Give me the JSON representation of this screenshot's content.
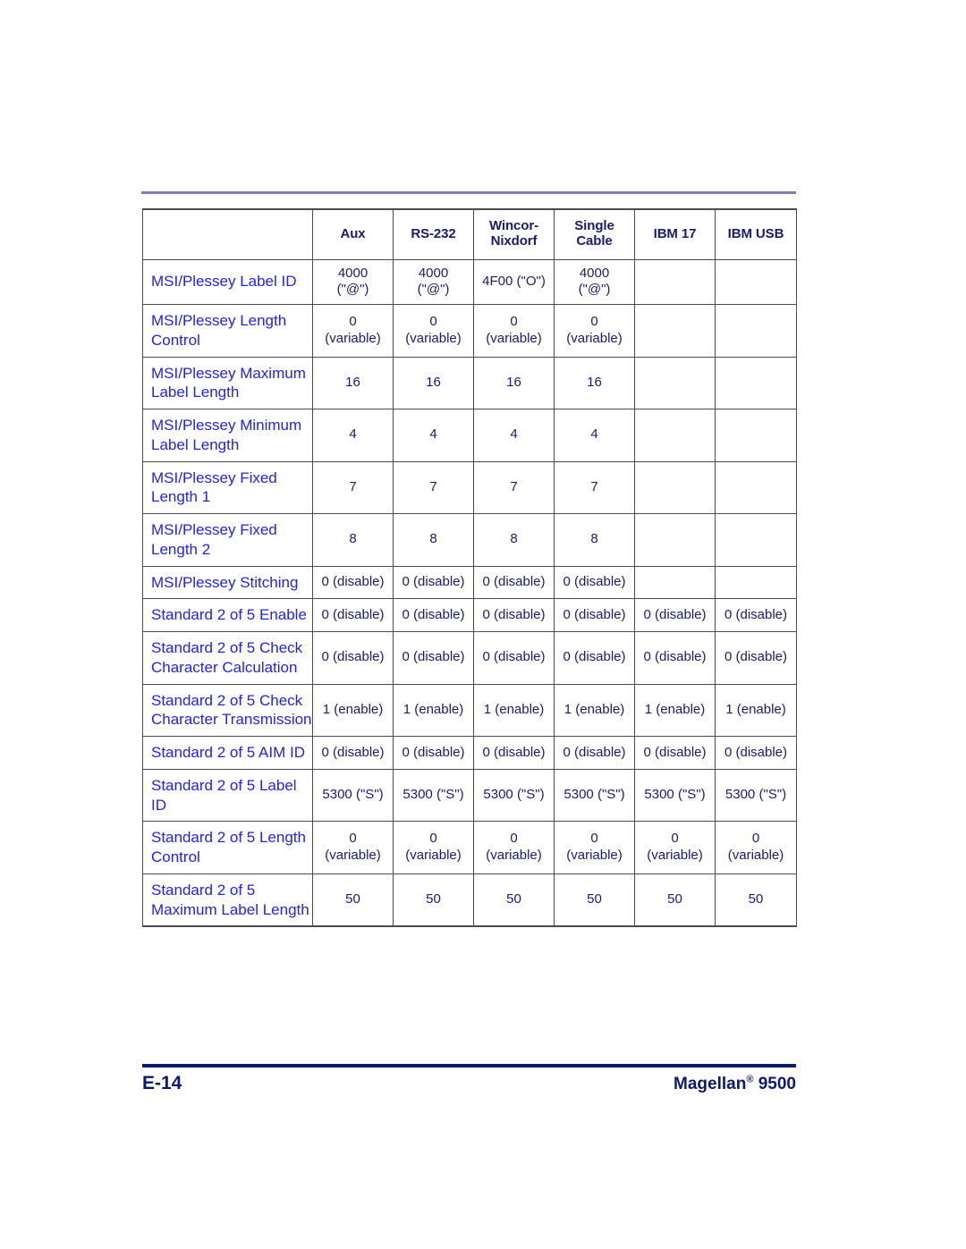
{
  "page": {
    "footer_page_number": "E-14",
    "footer_product_name": "Magellan",
    "footer_product_registered_mark": "®",
    "footer_product_model": "9500",
    "colors": {
      "row_label_blue": "#2222EE",
      "value_navy": "#1A1A6E",
      "footer_navy": "#0D1A6B",
      "top_rule_purple": "#7B7FB5",
      "table_border": "#4B4B4B"
    }
  },
  "table": {
    "columns": [
      {
        "key": "label",
        "header": ""
      },
      {
        "key": "aux",
        "header": "Aux"
      },
      {
        "key": "rs232",
        "header": "RS-232"
      },
      {
        "key": "wincor",
        "header": "Wincor-\nNixdorf"
      },
      {
        "key": "single",
        "header": "Single\nCable"
      },
      {
        "key": "ibm17",
        "header": "IBM 17"
      },
      {
        "key": "ibmusb",
        "header": "IBM USB"
      }
    ],
    "header_labels": {
      "blank": "",
      "aux": "Aux",
      "rs232": "RS-232",
      "wincor_line1": "Wincor-",
      "wincor_line2": "Nixdorf",
      "single_line1": "Single",
      "single_line2": "Cable",
      "ibm17": "IBM 17",
      "ibmusb": "IBM USB"
    },
    "rows": [
      {
        "label": "MSI/Plessey Label ID",
        "aux_main": "4000",
        "aux_sub": "(\"@\")",
        "rs232_main": "4000",
        "rs232_sub": "(\"@\")",
        "wincor_main": "4F00 (\"O\")",
        "wincor_sub": "",
        "single_main": "4000",
        "single_sub": "(\"@\")",
        "ibm17_main": "",
        "ibm17_sub": "",
        "ibmusb_main": "",
        "ibmusb_sub": ""
      },
      {
        "label": "MSI/Plessey Length Control",
        "aux_main": "0",
        "aux_sub": "(variable)",
        "rs232_main": "0",
        "rs232_sub": "(variable)",
        "wincor_main": "0",
        "wincor_sub": "(variable)",
        "single_main": "0",
        "single_sub": "(variable)",
        "ibm17_main": "",
        "ibm17_sub": "",
        "ibmusb_main": "",
        "ibmusb_sub": ""
      },
      {
        "label": "MSI/Plessey Maximum Label Length",
        "aux_main": "16",
        "aux_sub": "",
        "rs232_main": "16",
        "rs232_sub": "",
        "wincor_main": "16",
        "wincor_sub": "",
        "single_main": "16",
        "single_sub": "",
        "ibm17_main": "",
        "ibm17_sub": "",
        "ibmusb_main": "",
        "ibmusb_sub": ""
      },
      {
        "label": "MSI/Plessey Minimum Label Length",
        "aux_main": "4",
        "aux_sub": "",
        "rs232_main": "4",
        "rs232_sub": "",
        "wincor_main": "4",
        "wincor_sub": "",
        "single_main": "4",
        "single_sub": "",
        "ibm17_main": "",
        "ibm17_sub": "",
        "ibmusb_main": "",
        "ibmusb_sub": ""
      },
      {
        "label": "MSI/Plessey Fixed Length 1",
        "aux_main": "7",
        "aux_sub": "",
        "rs232_main": "7",
        "rs232_sub": "",
        "wincor_main": "7",
        "wincor_sub": "",
        "single_main": "7",
        "single_sub": "",
        "ibm17_main": "",
        "ibm17_sub": "",
        "ibmusb_main": "",
        "ibmusb_sub": ""
      },
      {
        "label": "MSI/Plessey Fixed Length 2",
        "aux_main": "8",
        "aux_sub": "",
        "rs232_main": "8",
        "rs232_sub": "",
        "wincor_main": "8",
        "wincor_sub": "",
        "single_main": "8",
        "single_sub": "",
        "ibm17_main": "",
        "ibm17_sub": "",
        "ibmusb_main": "",
        "ibmusb_sub": ""
      },
      {
        "label": "MSI/Plessey Stitching",
        "aux_main": "0 (disable)",
        "aux_sub": "",
        "rs232_main": "0 (disable)",
        "rs232_sub": "",
        "wincor_main": "0 (disable)",
        "wincor_sub": "",
        "single_main": "0 (disable)",
        "single_sub": "",
        "ibm17_main": "",
        "ibm17_sub": "",
        "ibmusb_main": "",
        "ibmusb_sub": ""
      },
      {
        "label": "Standard 2 of 5 Enable",
        "aux_main": "0 (disable)",
        "aux_sub": "",
        "rs232_main": "0 (disable)",
        "rs232_sub": "",
        "wincor_main": "0 (disable)",
        "wincor_sub": "",
        "single_main": "0 (disable)",
        "single_sub": "",
        "ibm17_main": "0 (disable)",
        "ibm17_sub": "",
        "ibmusb_main": "0 (disable)",
        "ibmusb_sub": ""
      },
      {
        "label": "Standard 2 of 5 Check Character Calculation",
        "aux_main": "0 (disable)",
        "aux_sub": "",
        "rs232_main": "0 (disable)",
        "rs232_sub": "",
        "wincor_main": "0 (disable)",
        "wincor_sub": "",
        "single_main": "0 (disable)",
        "single_sub": "",
        "ibm17_main": "0 (disable)",
        "ibm17_sub": "",
        "ibmusb_main": "0 (disable)",
        "ibmusb_sub": ""
      },
      {
        "label": "Standard 2 of 5 Check Character Transmission",
        "aux_main": "1 (enable)",
        "aux_sub": "",
        "rs232_main": "1 (enable)",
        "rs232_sub": "",
        "wincor_main": "1 (enable)",
        "wincor_sub": "",
        "single_main": "1 (enable)",
        "single_sub": "",
        "ibm17_main": "1 (enable)",
        "ibm17_sub": "",
        "ibmusb_main": "1 (enable)",
        "ibmusb_sub": ""
      },
      {
        "label": "Standard 2 of 5 AIM ID",
        "aux_main": "0 (disable)",
        "aux_sub": "",
        "rs232_main": "0 (disable)",
        "rs232_sub": "",
        "wincor_main": "0 (disable)",
        "wincor_sub": "",
        "single_main": "0 (disable)",
        "single_sub": "",
        "ibm17_main": "0 (disable)",
        "ibm17_sub": "",
        "ibmusb_main": "0 (disable)",
        "ibmusb_sub": ""
      },
      {
        "label": "Standard 2 of 5 Label ID",
        "aux_main": "5300 (\"S\")",
        "aux_sub": "",
        "rs232_main": "5300 (\"S\")",
        "rs232_sub": "",
        "wincor_main": "5300 (\"S\")",
        "wincor_sub": "",
        "single_main": "5300 (\"S\")",
        "single_sub": "",
        "ibm17_main": "5300 (\"S\")",
        "ibm17_sub": "",
        "ibmusb_main": "5300 (\"S\")",
        "ibmusb_sub": ""
      },
      {
        "label": "Standard 2 of 5 Length Control",
        "aux_main": "0",
        "aux_sub": "(variable)",
        "rs232_main": "0",
        "rs232_sub": "(variable)",
        "wincor_main": "0",
        "wincor_sub": "(variable)",
        "single_main": "0",
        "single_sub": "(variable)",
        "ibm17_main": "0",
        "ibm17_sub": "(variable)",
        "ibmusb_main": "0",
        "ibmusb_sub": "(variable)"
      },
      {
        "label": "Standard 2 of 5 Maximum Label Length",
        "aux_main": "50",
        "aux_sub": "",
        "rs232_main": "50",
        "rs232_sub": "",
        "wincor_main": "50",
        "wincor_sub": "",
        "single_main": "50",
        "single_sub": "",
        "ibm17_main": "50",
        "ibm17_sub": "",
        "ibmusb_main": "50",
        "ibmusb_sub": ""
      }
    ]
  }
}
